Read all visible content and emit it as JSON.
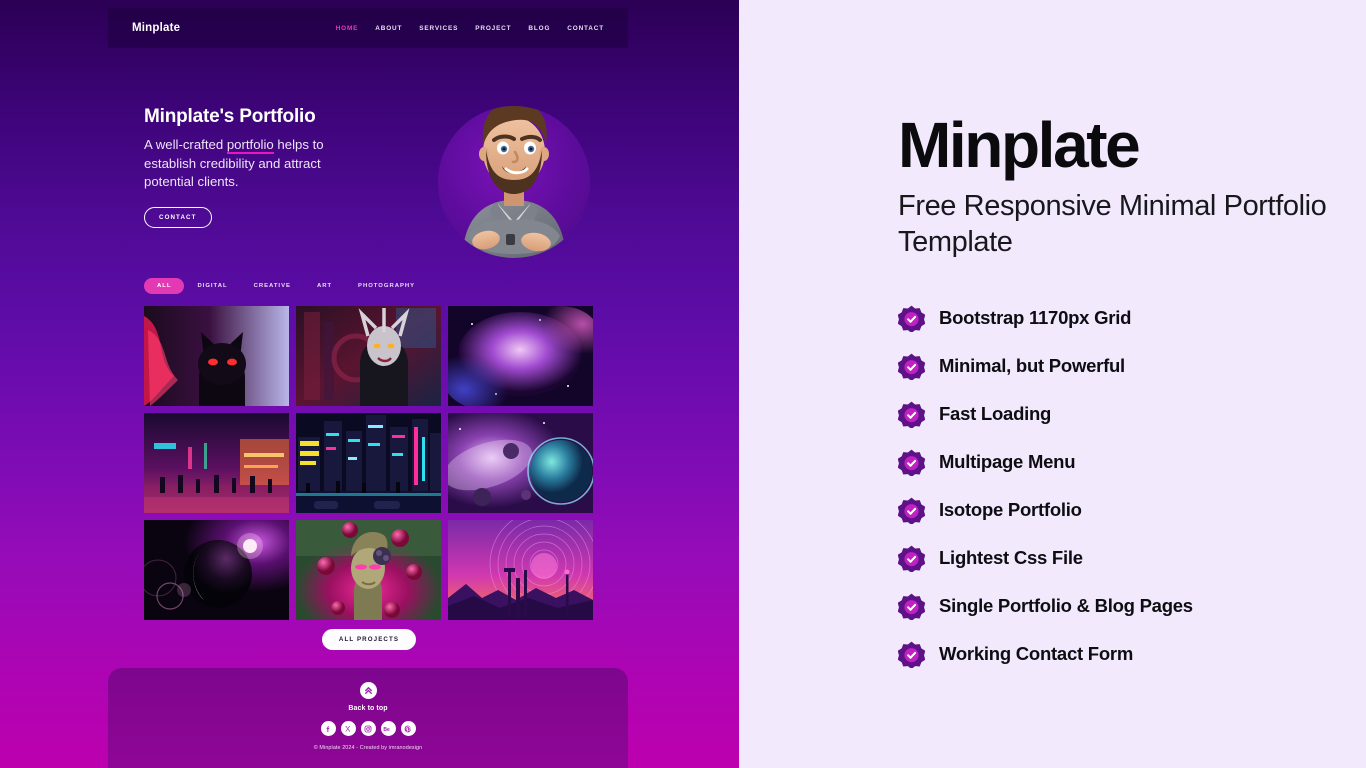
{
  "preview": {
    "navbar": {
      "brand": "Minplate",
      "links": [
        {
          "label": "HOME",
          "active": true
        },
        {
          "label": "ABOUT",
          "active": false
        },
        {
          "label": "SERVICES",
          "active": false
        },
        {
          "label": "PROJECT",
          "active": false
        },
        {
          "label": "BLOG",
          "active": false
        },
        {
          "label": "CONTACT",
          "active": false
        }
      ]
    },
    "hero": {
      "title": "Minplate's Portfolio",
      "sub_before": "A well-crafted ",
      "sub_highlight": "portfolio",
      "sub_after": " helps to establish credibility and attract potential clients.",
      "cta": "CONTACT",
      "avatar_alt": "3d-character-arms-crossed"
    },
    "filters": [
      {
        "label": "ALL",
        "active": true
      },
      {
        "label": "DIGITAL",
        "active": false
      },
      {
        "label": "CREATIVE",
        "active": false
      },
      {
        "label": "ART",
        "active": false
      },
      {
        "label": "PHOTOGRAPHY",
        "active": false
      }
    ],
    "portfolio": {
      "tiles": [
        {
          "name": "neon-cat-portrait"
        },
        {
          "name": "cyberpunk-figure"
        },
        {
          "name": "purple-nebula"
        },
        {
          "name": "neon-street-crowd"
        },
        {
          "name": "cyber-city-skyline"
        },
        {
          "name": "planet-space-scene"
        },
        {
          "name": "dark-glass-sphere"
        },
        {
          "name": "classical-bust-spheres"
        },
        {
          "name": "retro-future-landscape"
        }
      ],
      "all_projects_label": "ALL PROJECTS"
    },
    "footer": {
      "back_to_top_label": "Back to top",
      "socials": [
        {
          "name": "facebook",
          "glyph": "f"
        },
        {
          "name": "x-twitter",
          "glyph": "✕"
        },
        {
          "name": "instagram",
          "glyph": "◎"
        },
        {
          "name": "behance",
          "glyph": "Be"
        },
        {
          "name": "pinterest",
          "glyph": "P"
        }
      ],
      "copyright": "© Minplate 2024 - Created by imranodesign"
    }
  },
  "panel": {
    "title": "Minplate",
    "subtitle": "Free Responsive Minimal Portfolio Template",
    "features": [
      {
        "label": "Bootstrap 1170px Grid"
      },
      {
        "label": "Minimal, but Powerful"
      },
      {
        "label": "Fast Loading"
      },
      {
        "label": "Multipage Menu"
      },
      {
        "label": "Isotope Portfolio"
      },
      {
        "label": "Lightest Css File"
      },
      {
        "label": "Single Portfolio & Blog Pages"
      },
      {
        "label": "Working Contact Form"
      }
    ]
  },
  "colors": {
    "accent_pink": "#e33ab4",
    "badge_outer": "#5b1385",
    "badge_inner": "#c41ec4",
    "panel_bg": "#f3e9fd",
    "preview_top": "#2b0055",
    "preview_bottom": "#bd00ae"
  }
}
